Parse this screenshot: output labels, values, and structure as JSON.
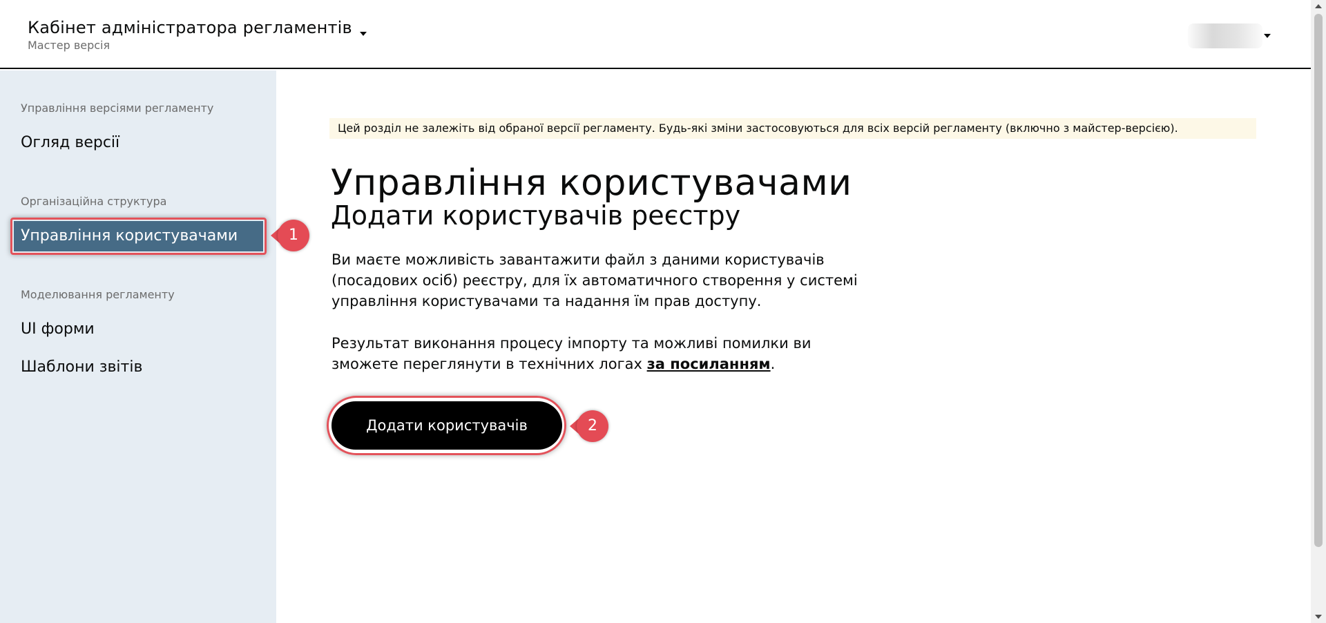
{
  "header": {
    "app_title": "Кабінет адміністратора регламентів",
    "version_label": "Мастер версія",
    "version_dropdown_icon": "chevron-down-icon",
    "user_dropdown_icon": "chevron-down-icon"
  },
  "sidebar": {
    "sections": [
      {
        "label": "Управління версіями регламенту",
        "items": [
          "Огляд версії"
        ]
      },
      {
        "label": "Організаційна структура",
        "items": [
          "Управління користувачами"
        ]
      },
      {
        "label": "Моделювання регламенту",
        "items": [
          "UI форми",
          "Шаблони звітів"
        ]
      }
    ],
    "active_item": "Управління користувачами",
    "active_color": "#466b86",
    "background": "#e6edf3"
  },
  "main": {
    "notice": "Цей розділ не залежіть від обраної версії регламенту. Будь-які зміни застосовуються для всіх версій регламенту (включно з майстер-версією).",
    "title": "Управління користувачами",
    "subtitle": "Додати користувачів реєстру",
    "paragraph1_lines": [
      "Ви маєте можливість завантажити файл з даними користувачів",
      "(посадових осіб) реєстру, для їх автоматичного створення у системі",
      "управління користувачами та надання їм прав доступу."
    ],
    "paragraph2_line1": "Результат виконання процесу імпорту та можливі помилки ви",
    "paragraph2_line2_prefix": "зможете переглянути в технічних логах ",
    "paragraph2_link": "за посиланням",
    "paragraph2_suffix": ".",
    "add_users_button": "Додати користувачів"
  },
  "annotations": {
    "badge_1": "1",
    "badge_2": "2",
    "color": "#e44b55"
  }
}
